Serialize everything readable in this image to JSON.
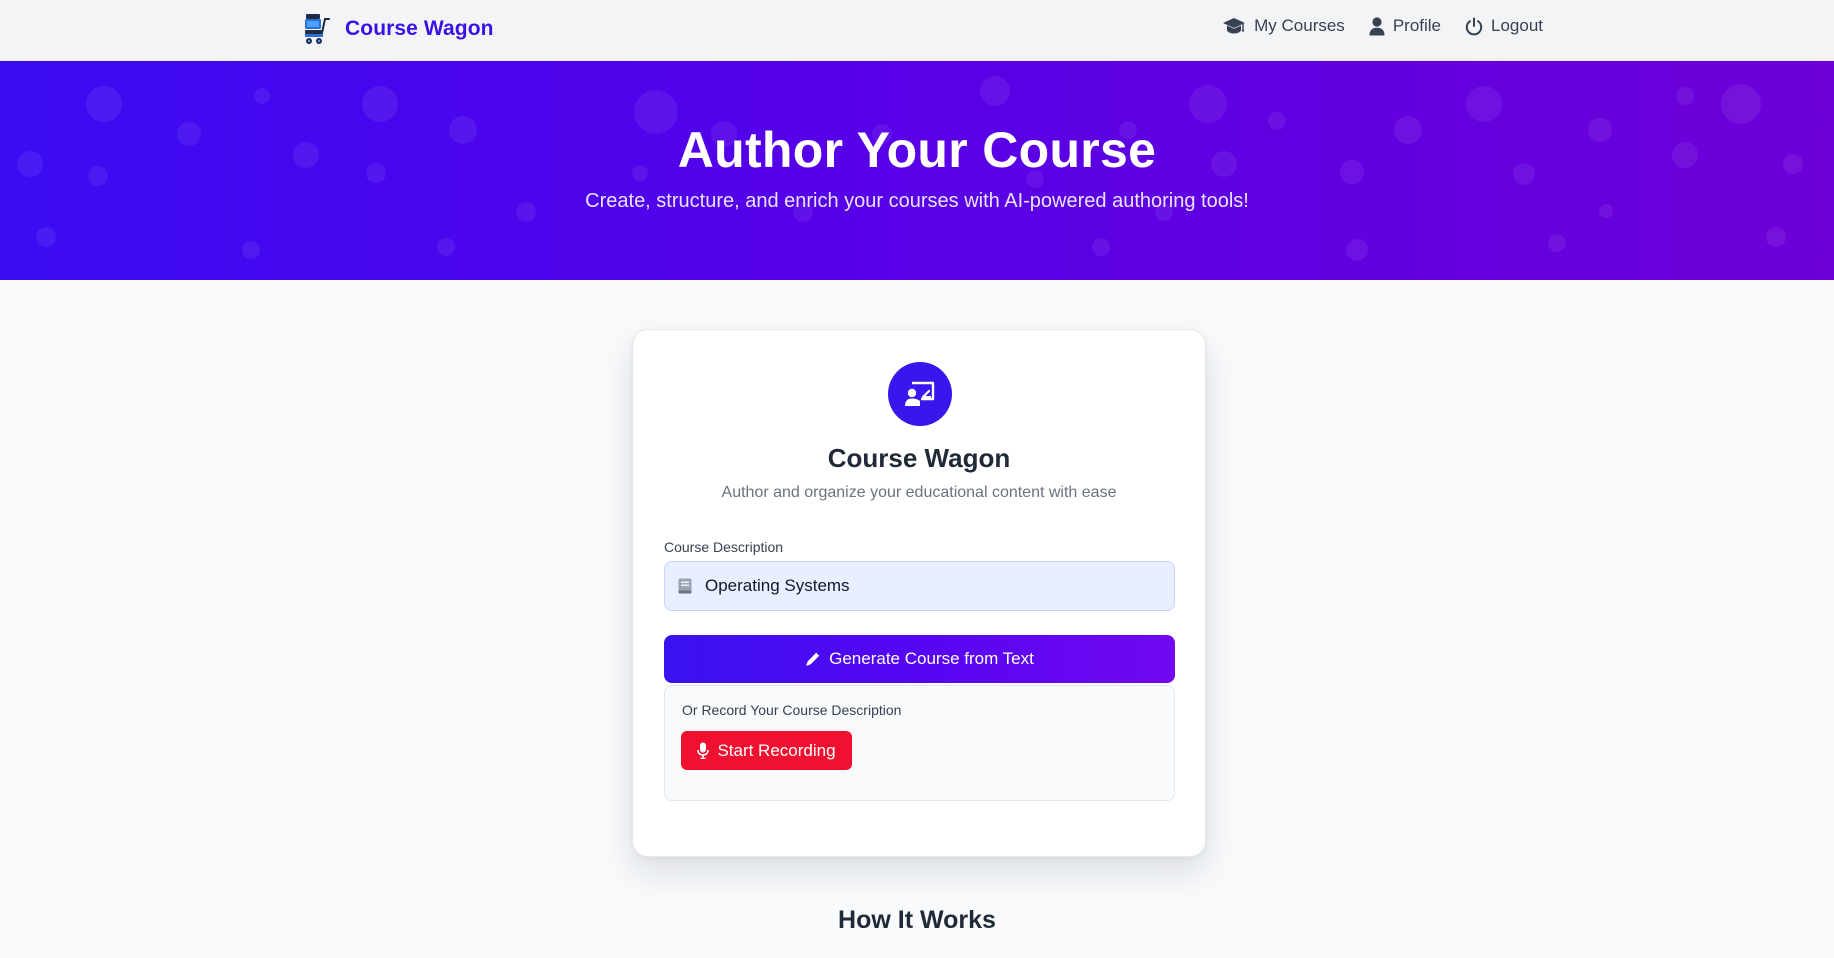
{
  "navbar": {
    "brand": "Course Wagon",
    "brand_icon": "wagon-cart-icon",
    "links": [
      {
        "label": "My Courses",
        "icon": "graduation-cap-icon"
      },
      {
        "label": "Profile",
        "icon": "user-icon"
      },
      {
        "label": "Logout",
        "icon": "power-icon"
      }
    ]
  },
  "hero": {
    "title": "Author Your Course",
    "subtitle": "Create, structure, and enrich your courses with AI-powered authoring tools!"
  },
  "card": {
    "badge_icon": "chalkboard-teacher-icon",
    "title": "Course Wagon",
    "subtitle": "Author and organize your educational content with ease",
    "field_label": "Course Description",
    "field_icon": "book-icon",
    "field_value": "Operating Systems",
    "generate_label": "Generate Course from Text",
    "generate_icon": "pencil-icon",
    "record_label": "Or Record Your Course Description",
    "record_button": "Start Recording",
    "record_icon": "microphone-icon"
  },
  "how_it_works": {
    "title": "How It Works"
  },
  "colors": {
    "brand": "#3b12e6",
    "hero_start": "#3a0cf2",
    "hero_end": "#6d00d8",
    "record_red": "#f0102f"
  }
}
